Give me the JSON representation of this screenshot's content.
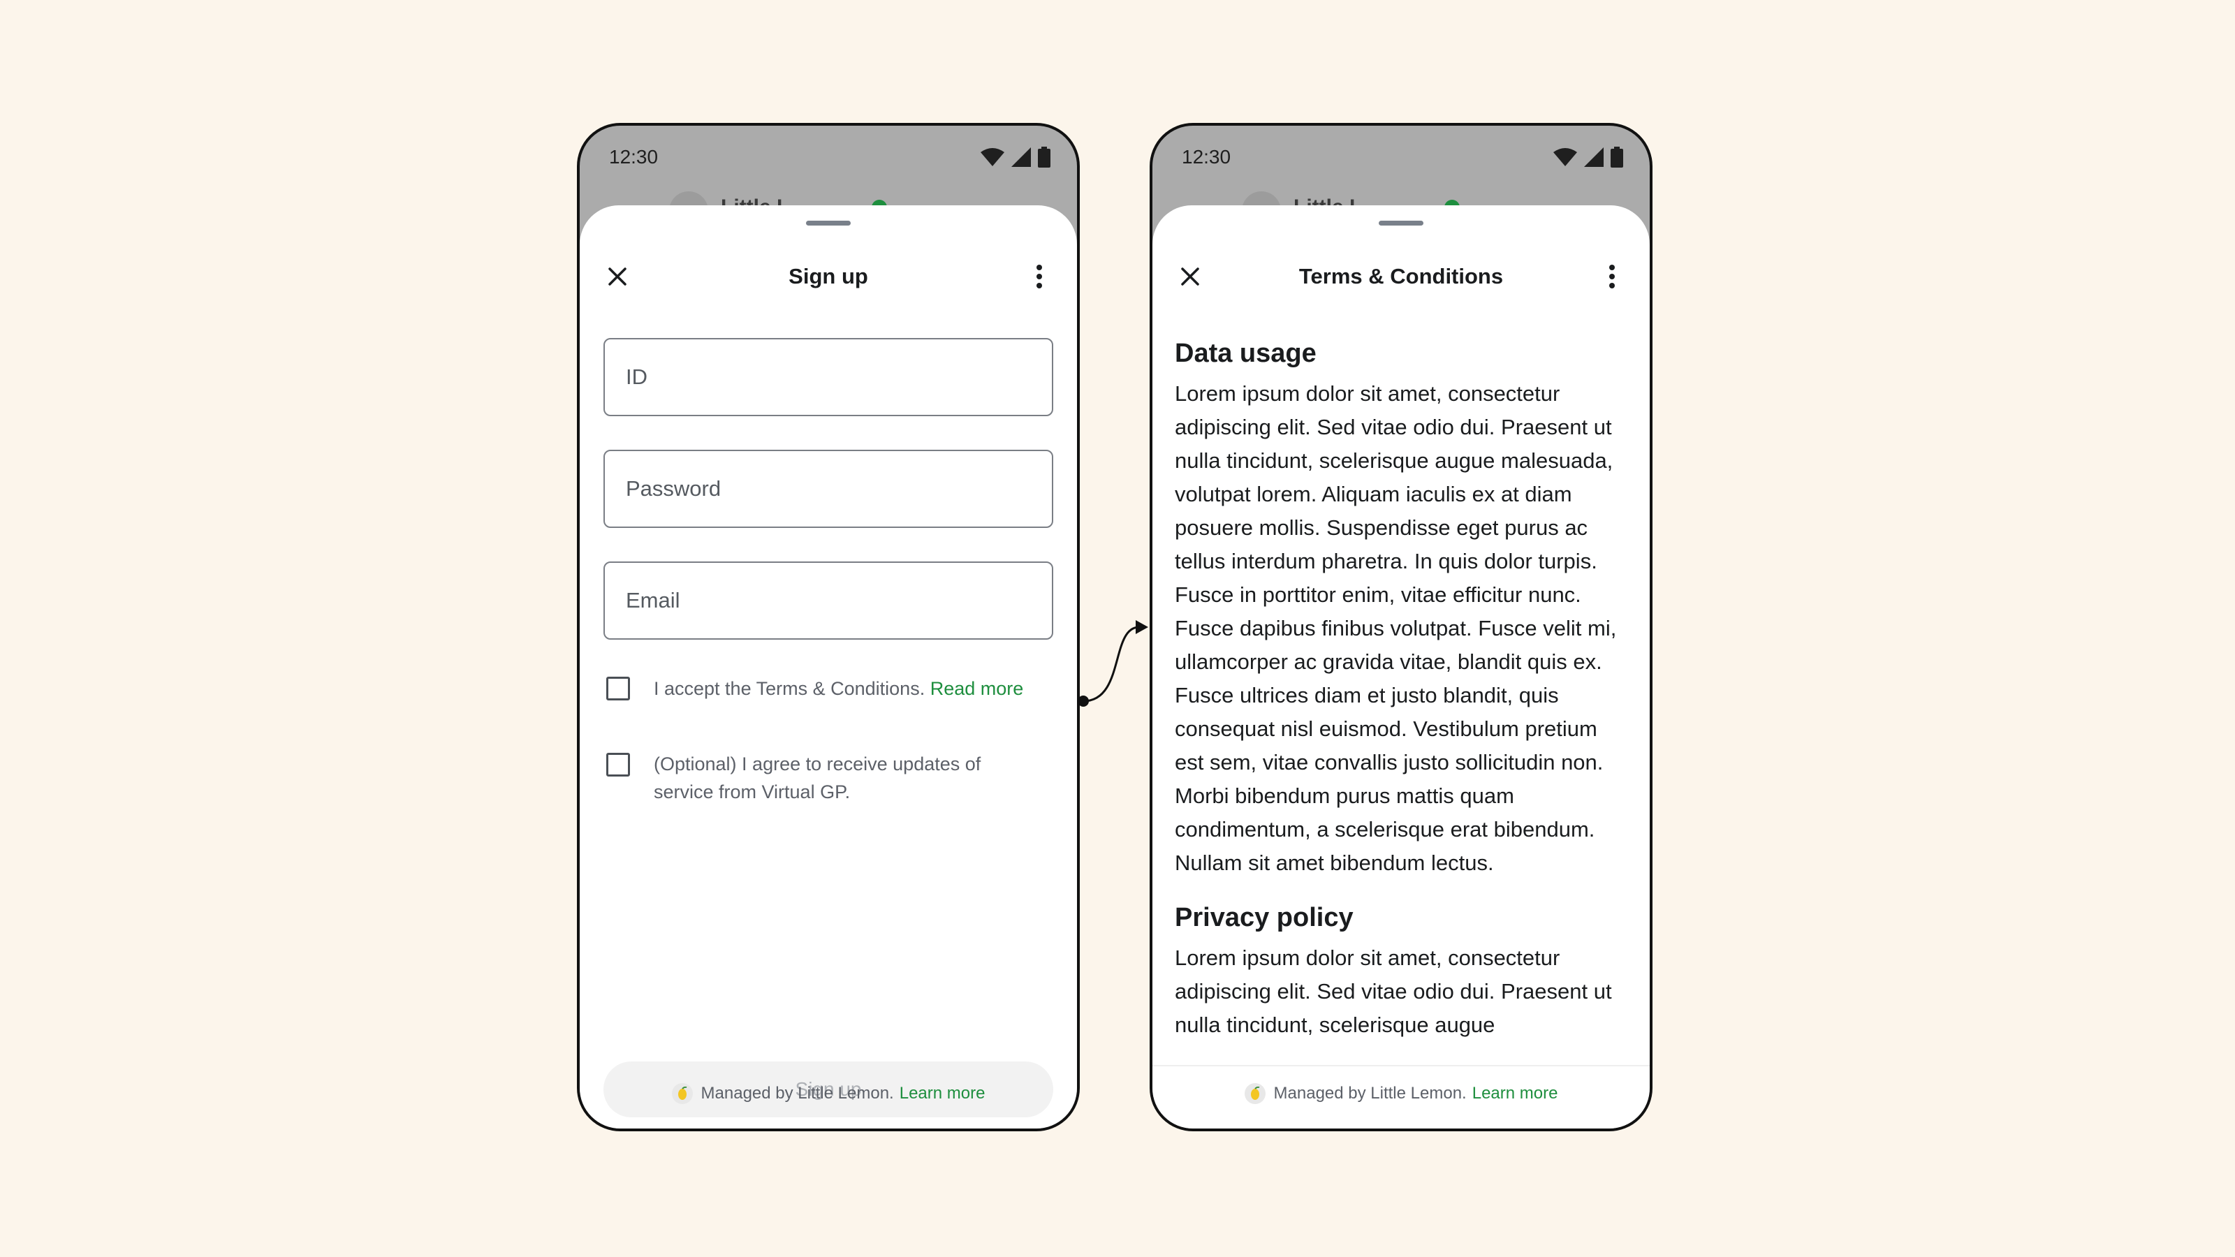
{
  "status": {
    "time": "12:30"
  },
  "background_peek": {
    "title_partial": "Little L"
  },
  "signup_sheet": {
    "title": "Sign up",
    "fields": {
      "id_placeholder": "ID",
      "password_placeholder": "Password",
      "email_placeholder": "Email"
    },
    "terms_checkbox": {
      "text": "I accept the Terms & Conditions.",
      "link": "Read more"
    },
    "updates_checkbox": {
      "line1": "(Optional) I agree to receive updates of",
      "line2": "service from Virtual GP."
    },
    "submit_label": "Sign up",
    "footer": {
      "text": "Managed by Little Lemon.",
      "link": "Learn more"
    }
  },
  "terms_sheet": {
    "title": "Terms & Conditions",
    "sections": [
      {
        "heading": "Data usage",
        "body": "Lorem ipsum dolor sit amet, consectetur adipiscing elit. Sed vitae odio dui. Praesent ut nulla tincidunt, scelerisque augue malesuada, volutpat lorem. Aliquam iaculis ex at diam posuere mollis. Suspendisse eget purus ac tellus interdum pharetra. In quis dolor turpis. Fusce in porttitor enim, vitae efficitur nunc. Fusce dapibus finibus volutpat. Fusce velit mi, ullamcorper ac gravida vitae, blandit quis ex. Fusce ultrices diam et justo blandit, quis consequat nisl euismod. Vestibulum pretium est sem, vitae convallis justo sollicitudin non. Morbi bibendum purus mattis quam condimentum, a scelerisque erat bibendum. Nullam sit amet bibendum lectus."
      },
      {
        "heading": "Privacy policy",
        "body": "Lorem ipsum dolor sit amet, consectetur adipiscing elit. Sed vitae odio dui. Praesent ut nulla tincidunt, scelerisque augue"
      }
    ],
    "footer": {
      "text": "Managed by Little Lemon.",
      "link": "Learn more"
    }
  },
  "colors": {
    "background": "#fcf5eb",
    "accent_link": "#1e8e3e",
    "status_bar": "#ababab"
  }
}
